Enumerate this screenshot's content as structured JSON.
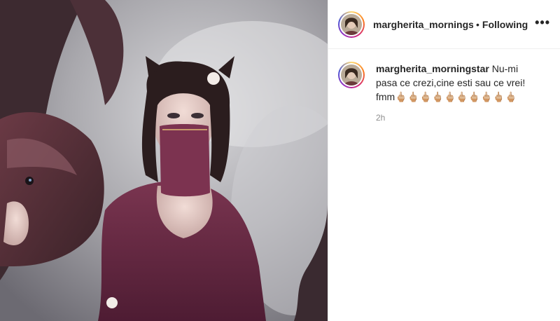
{
  "post": {
    "username": "margherita_morningstar",
    "header_username": "margherita_morningsta",
    "separator": "•",
    "follow_status": "Following",
    "more_label": "•••",
    "caption": {
      "username": "margherita_morningstar",
      "text": "Nu-mi pasa ce crezi,cine esti sau ce vrei! fmm🖕🏼🖕🏼🖕🏼🖕🏼🖕🏼🖕🏼🖕🏼🖕🏼🖕🏼🖕🏼",
      "time_ago": "2h"
    }
  },
  "icons": {
    "more": "more-options-icon",
    "avatar": "profile-avatar"
  }
}
